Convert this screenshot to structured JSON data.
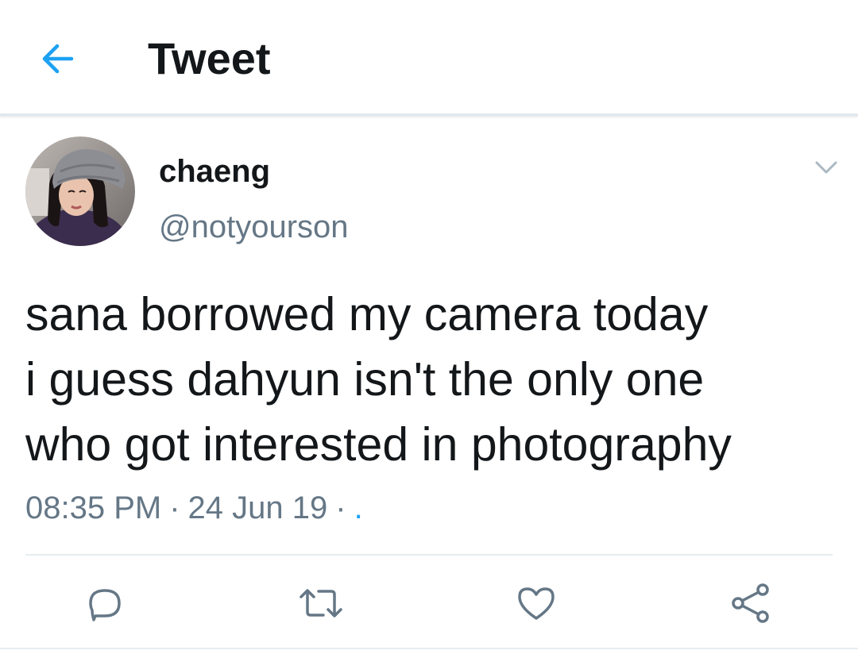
{
  "header": {
    "back_icon": "arrow-left-icon",
    "title": "Tweet",
    "accent": "#1da1f2"
  },
  "tweet": {
    "display_name": "chaeng",
    "handle": "@notyourson",
    "avatar_icon": "profile-photo",
    "menu_icon": "chevron-down-icon",
    "text_lines": [
      "sana borrowed my camera today",
      "i guess dahyun isn't the only one",
      "who got interested in photography"
    ],
    "time": "08:35 PM",
    "separator": "·",
    "date": "24 Jun 19",
    "source": "."
  },
  "actions": [
    {
      "name": "reply",
      "icon": "reply-bubble-icon"
    },
    {
      "name": "retweet",
      "icon": "retweet-icon"
    },
    {
      "name": "like",
      "icon": "heart-icon"
    },
    {
      "name": "share",
      "icon": "share-icon"
    }
  ],
  "colors": {
    "text_primary": "#14171a",
    "text_secondary": "#657786",
    "icon_gray": "#657786",
    "divider": "#e6ecf0"
  }
}
